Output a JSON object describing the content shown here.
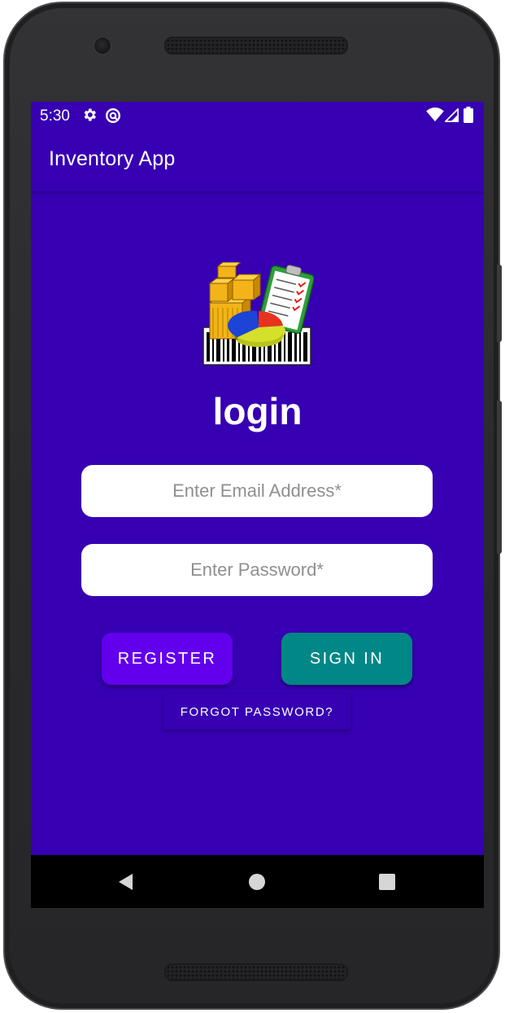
{
  "status_bar": {
    "time": "5:30",
    "icons": [
      "settings-gear-icon",
      "data-saver-icon",
      "wifi-icon",
      "signal-icon",
      "battery-icon"
    ]
  },
  "app_bar": {
    "title": "Inventory App"
  },
  "login": {
    "logo_icon": "inventory-logo-icon",
    "title": "login",
    "email_placeholder": "Enter Email Address*",
    "email_value": "",
    "password_placeholder": "Enter Password*",
    "password_value": "",
    "register_label": "REGISTER",
    "signin_label": "SIGN IN",
    "forgot_label": "FORGOT PASSWORD?"
  },
  "nav_bar": {
    "icons": [
      "back-icon",
      "home-icon",
      "recents-icon"
    ]
  },
  "colors": {
    "primary": "#3700b3",
    "register_button": "#6200ee",
    "signin_button": "#018786",
    "nav_bar": "#000000"
  }
}
